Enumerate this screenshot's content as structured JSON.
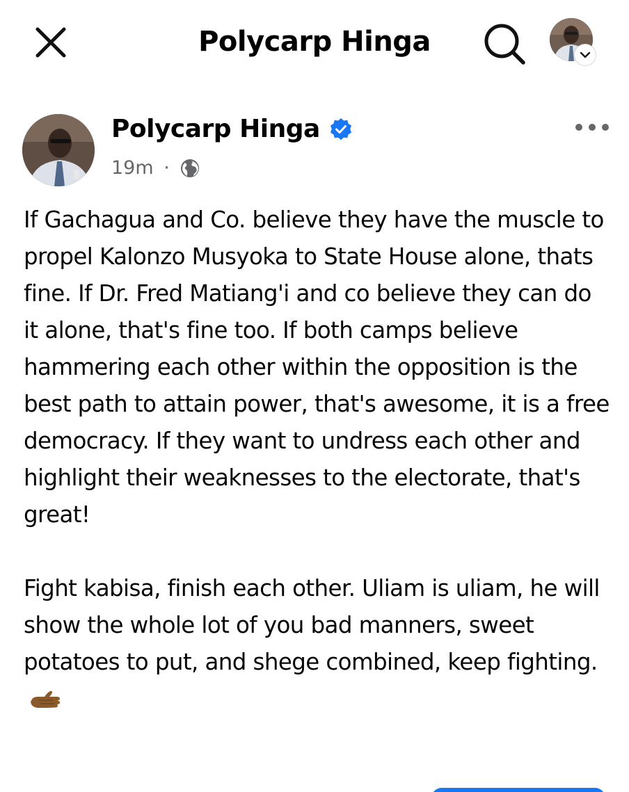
{
  "topbar": {
    "title": "Polycarp Hinga",
    "close_icon": "close-icon",
    "search_icon": "search-icon",
    "profile_icon": "profile-avatar",
    "dropdown_icon": "chevron-down-icon"
  },
  "post": {
    "author": "Polycarp Hinga",
    "verified": true,
    "time": "19m",
    "separator": "·",
    "audience_icon": "globe-icon",
    "more_icon": "more-horizontal-icon",
    "paragraphs": [
      "If Gachagua and Co. believe they have the muscle to propel Kalonzo Musyoka to State House alone, thats fine. If Dr. Fred Matiang'i and co believe they can do it alone, that's fine too. If both camps believe hammering each other within the opposition is the best path to attain power, that's awesome, it is a free democracy. If they want to undress each other and highlight their weaknesses to the electorate, that's great!",
      "Fight kabisa, finish each other. Uliam is uliam, he will show the whole lot of you bad manners, sweet potatoes to put, and shege combined, keep fighting."
    ],
    "trailing_emoji": "palm-up-hand-emoji"
  },
  "colors": {
    "verified_blue": "#1877f2",
    "meta_gray": "#65676b",
    "text": "#050505"
  }
}
